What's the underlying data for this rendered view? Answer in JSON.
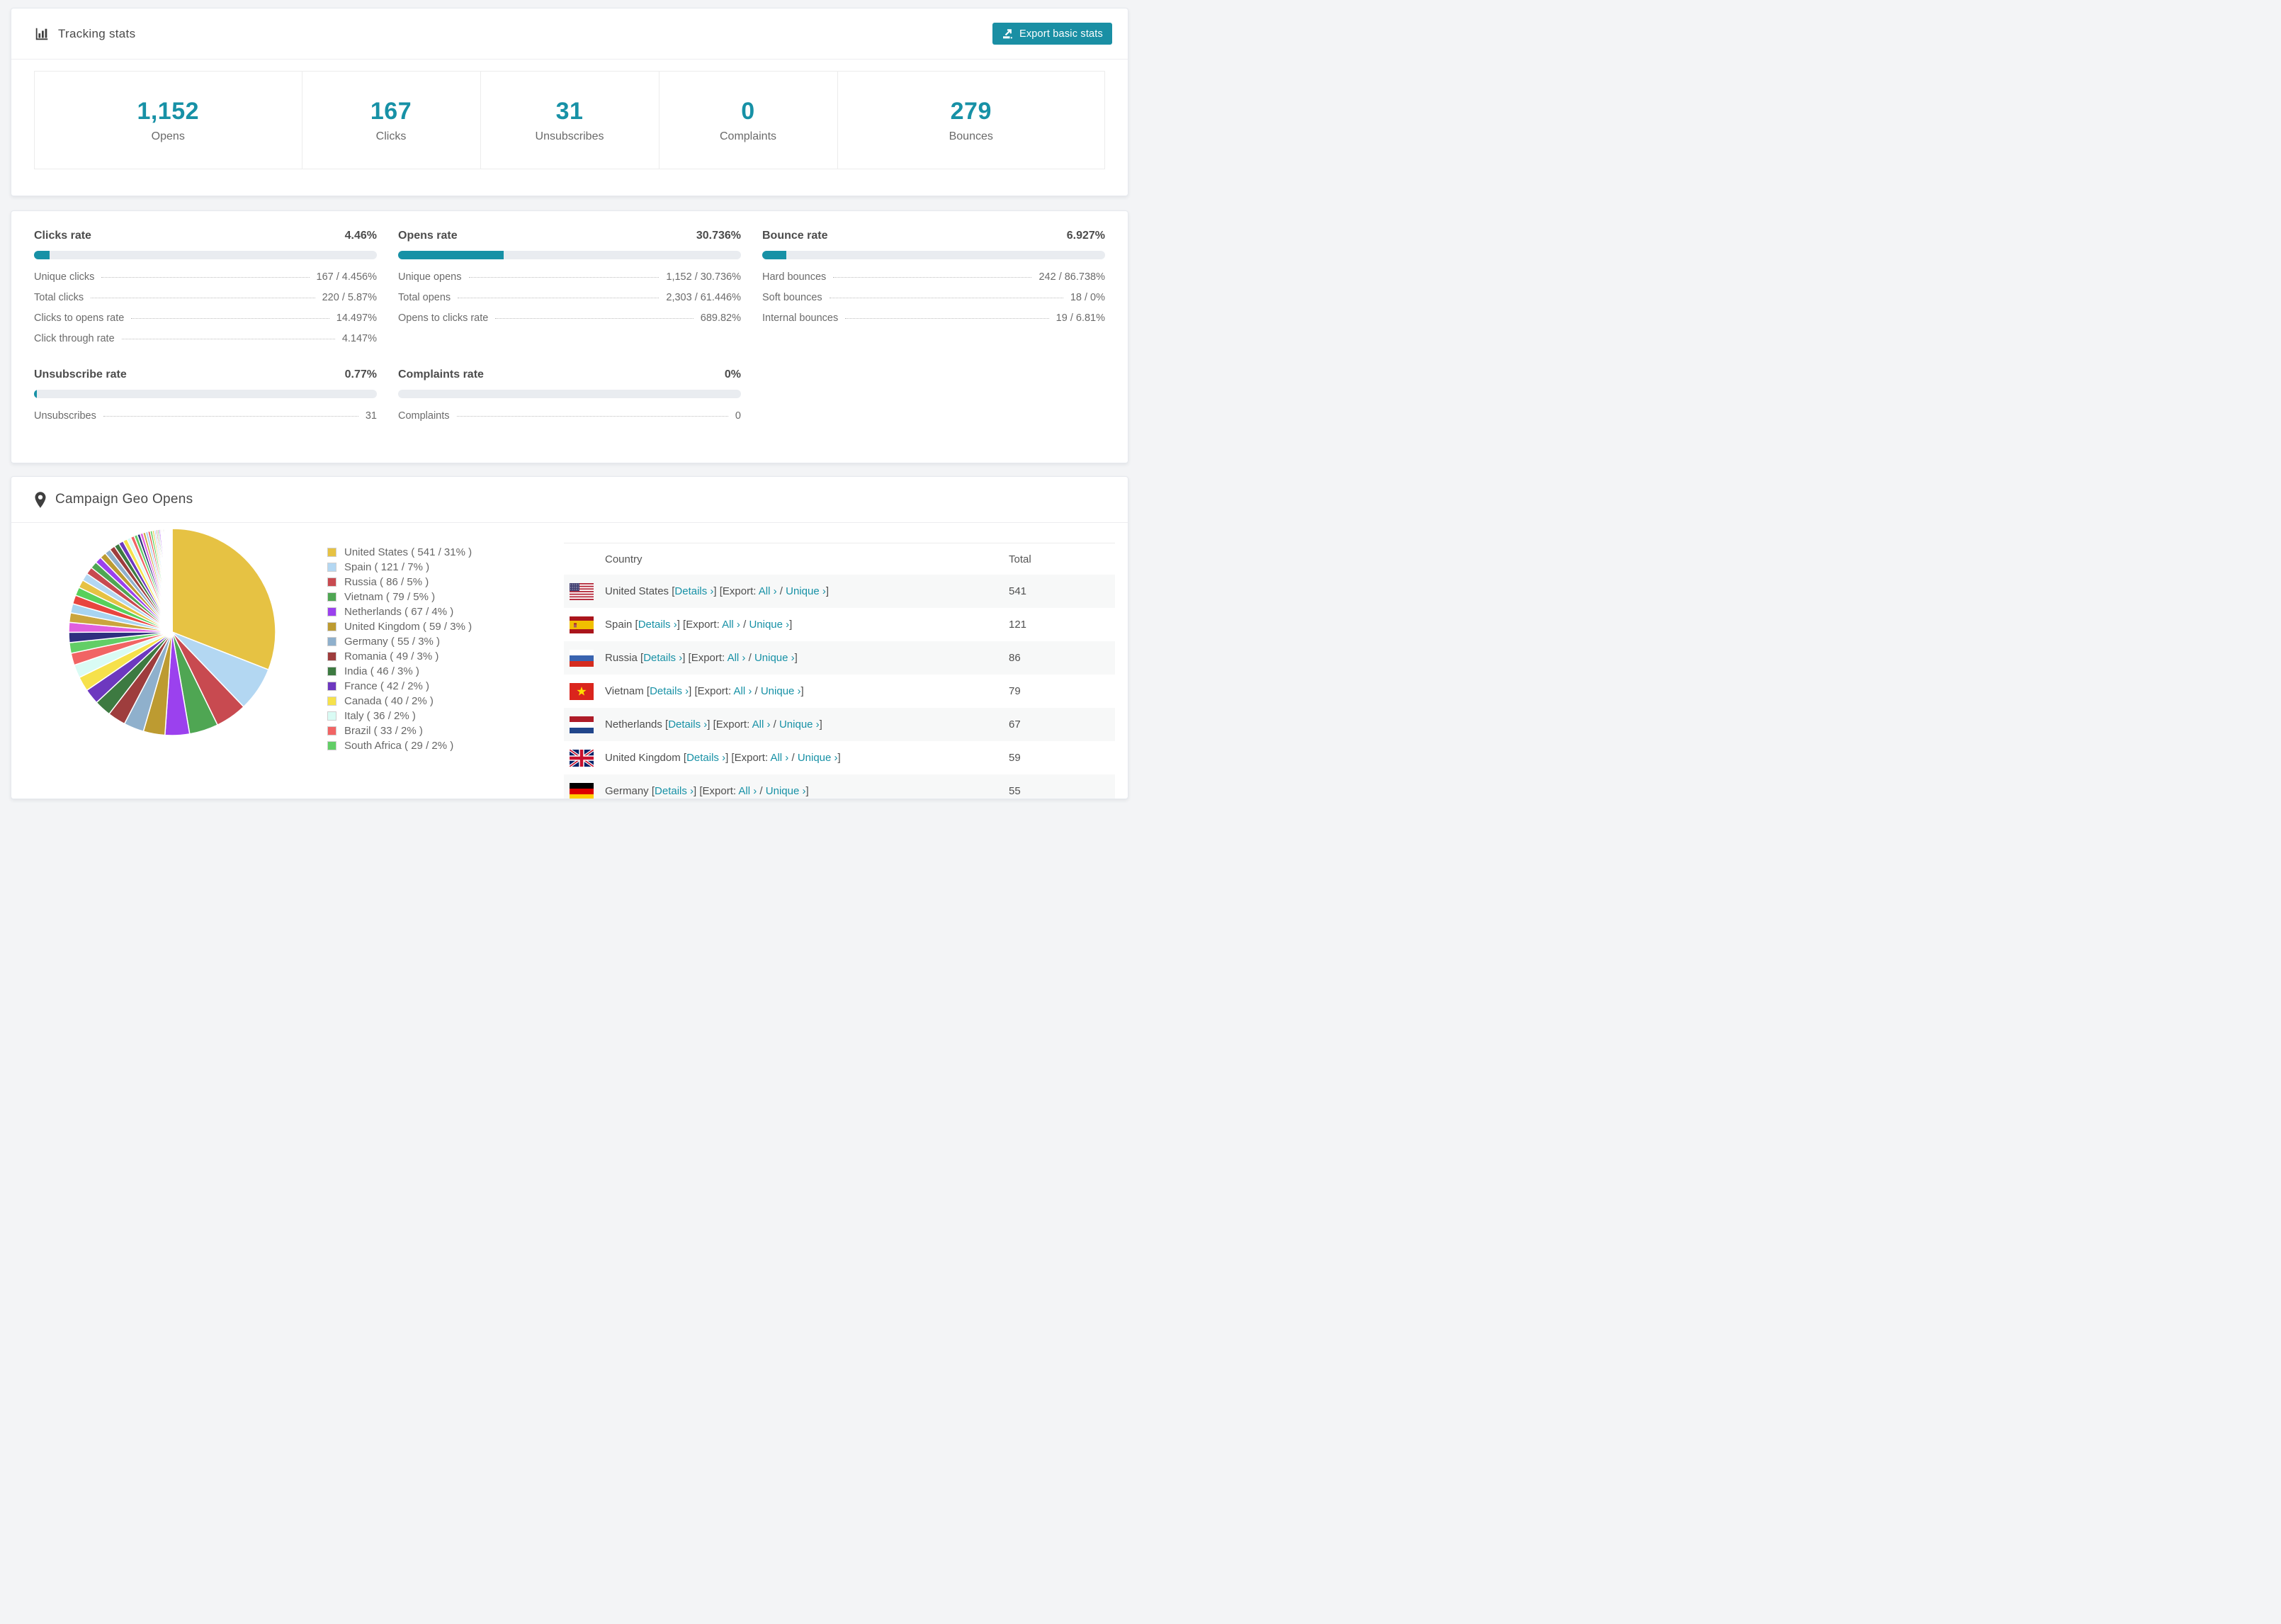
{
  "brand": {
    "teal": "#1791a6",
    "button_teal": "#1a8fa4"
  },
  "tracking": {
    "title": "Tracking stats",
    "export_button": "Export basic stats"
  },
  "summary": [
    {
      "value": "1,152",
      "label": "Opens"
    },
    {
      "value": "167",
      "label": "Clicks"
    },
    {
      "value": "31",
      "label": "Unsubscribes"
    },
    {
      "value": "0",
      "label": "Complaints"
    },
    {
      "value": "279",
      "label": "Bounces"
    }
  ],
  "rates": [
    {
      "title": "Clicks rate",
      "value": "4.46%",
      "percent": 4.46,
      "rows": [
        [
          "Unique clicks",
          "167 / 4.456%"
        ],
        [
          "Total clicks",
          "220 / 5.87%"
        ],
        [
          "Clicks to opens rate",
          "14.497%"
        ],
        [
          "Click through rate",
          "4.147%"
        ]
      ]
    },
    {
      "title": "Opens rate",
      "value": "30.736%",
      "percent": 30.736,
      "rows": [
        [
          "Unique opens",
          "1,152 / 30.736%"
        ],
        [
          "Total opens",
          "2,303 / 61.446%"
        ],
        [
          "Opens to clicks rate",
          "689.82%"
        ]
      ]
    },
    {
      "title": "Bounce rate",
      "value": "6.927%",
      "percent": 6.927,
      "rows": [
        [
          "Hard bounces",
          "242 / 86.738%"
        ],
        [
          "Soft bounces",
          "18 / 0%"
        ],
        [
          "Internal bounces",
          "19 / 6.81%"
        ]
      ]
    },
    {
      "title": "Unsubscribe rate",
      "value": "0.77%",
      "percent": 0.77,
      "rows": [
        [
          "Unsubscribes",
          "31"
        ]
      ]
    },
    {
      "title": "Complaints rate",
      "value": "0%",
      "percent": 0,
      "rows": [
        [
          "Complaints",
          "0"
        ]
      ]
    }
  ],
  "geo": {
    "title": "Campaign Geo Opens",
    "table": {
      "headers": [
        "Country",
        "Total"
      ],
      "link_labels": {
        "details": "Details",
        "export": "Export:",
        "all": "All",
        "unique": "Unique",
        "chevron": "›"
      },
      "rows": [
        {
          "country": "United States",
          "flag": "us",
          "total": "541"
        },
        {
          "country": "Spain",
          "flag": "es",
          "total": "121"
        },
        {
          "country": "Russia",
          "flag": "ru",
          "total": "86"
        },
        {
          "country": "Vietnam",
          "flag": "vn",
          "total": "79"
        },
        {
          "country": "Netherlands",
          "flag": "nl",
          "total": "67"
        },
        {
          "country": "United Kingdom",
          "flag": "gb",
          "total": "59"
        },
        {
          "country": "Germany",
          "flag": "de",
          "total": "55"
        }
      ]
    }
  },
  "chart_data": {
    "type": "pie",
    "title": "Campaign Geo Opens",
    "legend_position": "right",
    "start_angle_deg": -90,
    "direction": "clockwise",
    "series": [
      {
        "name": "United States",
        "value": 541,
        "pct": "31"
      },
      {
        "name": "Spain",
        "value": 121,
        "pct": "7"
      },
      {
        "name": "Russia",
        "value": 86,
        "pct": "5"
      },
      {
        "name": "Vietnam",
        "value": 79,
        "pct": "5"
      },
      {
        "name": "Netherlands",
        "value": 67,
        "pct": "4"
      },
      {
        "name": "United Kingdom",
        "value": 59,
        "pct": "3"
      },
      {
        "name": "Germany",
        "value": 55,
        "pct": "3"
      },
      {
        "name": "Romania",
        "value": 49,
        "pct": "3"
      },
      {
        "name": "India",
        "value": 46,
        "pct": "3"
      },
      {
        "name": "France",
        "value": 42,
        "pct": "2"
      },
      {
        "name": "Canada",
        "value": 40,
        "pct": "2"
      },
      {
        "name": "Italy",
        "value": 36,
        "pct": "2"
      },
      {
        "name": "Brazil",
        "value": 33,
        "pct": "2"
      },
      {
        "name": "South Africa",
        "value": 29,
        "pct": "2"
      }
    ],
    "others_values": [
      28,
      27,
      26,
      25,
      24,
      23,
      22,
      21,
      20,
      19,
      18,
      17,
      16,
      15,
      14,
      13,
      12,
      11,
      10,
      9,
      8,
      8,
      7,
      7,
      6,
      6,
      5,
      5,
      4,
      4,
      4,
      3,
      3,
      3,
      3,
      2,
      2,
      2,
      2,
      2,
      1,
      1,
      1,
      1,
      1,
      1,
      1,
      1,
      1,
      1
    ],
    "palette": [
      "#e6c243",
      "#b3d7f2",
      "#c84a50",
      "#4fa653",
      "#9b41ee",
      "#bd9b31",
      "#8fb0cc",
      "#9e3d3d",
      "#3d7a41",
      "#6d38bf",
      "#f6e14b",
      "#d9fbf4",
      "#f16464",
      "#62ce66",
      "#2f2f80",
      "#e05fe0",
      "#caa53d",
      "#a8d4f0",
      "#e8453f",
      "#58d05b"
    ]
  }
}
